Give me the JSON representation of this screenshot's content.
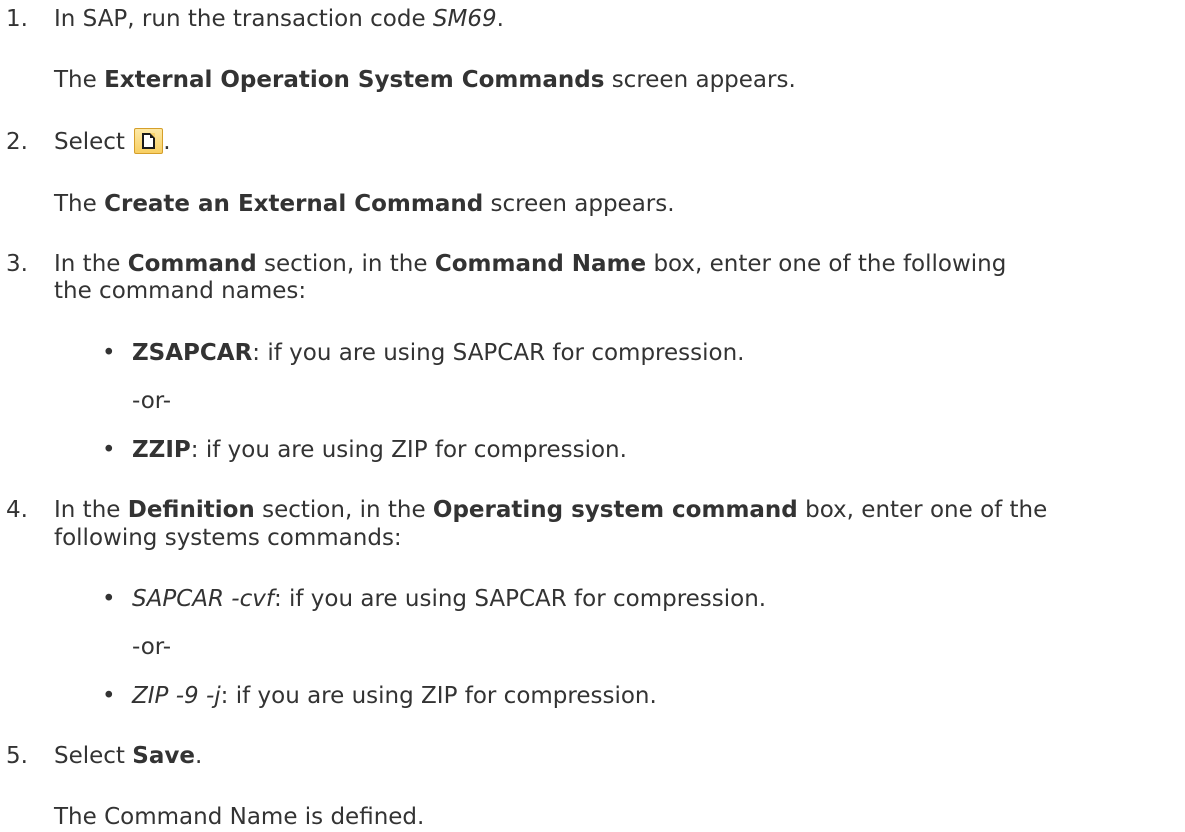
{
  "steps": [
    {
      "number": "1.",
      "parts": {
        "a": "In SAP, run the transaction code ",
        "b": "SM69",
        "c": "."
      },
      "result": {
        "a": "The ",
        "b": "External Operation System Commands",
        "c": " screen appears."
      }
    },
    {
      "number": "2.",
      "parts": {
        "a": "Select ",
        "icon": "new-document-icon",
        "c": "."
      },
      "result": {
        "a": "The ",
        "b": "Create an External Command",
        "c": " screen appears."
      }
    },
    {
      "number": "3.",
      "parts": {
        "a": "In the ",
        "b": "Command",
        "c": " section, in the ",
        "d": "Command Name",
        "e": " box, enter one of the following",
        "f": "the command names:"
      },
      "bullets": [
        {
          "term": "ZSAPCAR",
          "text": ": if you are using SAPCAR for compression."
        },
        {
          "term": "ZZIP",
          "text": ": if you are using ZIP for compression."
        }
      ],
      "or": "-or-"
    },
    {
      "number": "4.",
      "parts": {
        "a": "In the ",
        "b": "Definition",
        "c": " section, in the ",
        "d": "Operating system command",
        "e": " box, enter one of the",
        "f": "following systems commands:"
      },
      "bullets": [
        {
          "term": "SAPCAR -cvf",
          "text": ": if you are using SAPCAR for compression."
        },
        {
          "term": "ZIP -9 -j",
          "text": ": if you are using ZIP for compression."
        }
      ],
      "or": "-or-"
    },
    {
      "number": "5.",
      "parts": {
        "a": "Select ",
        "b": "Save",
        "c": "."
      },
      "result": {
        "a": "The Command Name is defined."
      }
    }
  ],
  "bullet_glyph": "•"
}
